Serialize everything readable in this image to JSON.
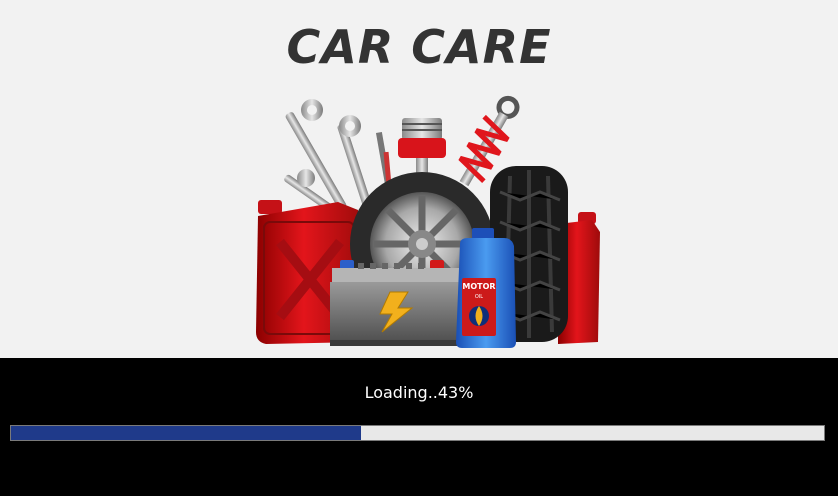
{
  "splash": {
    "logo_title": "CAR CARE",
    "status_text": "Loading..43%",
    "progress_fraction": 0.43,
    "oil_label_top": "MOTOR",
    "oil_label_bottom": "OIL"
  },
  "colors": {
    "top_background": "#f2f2f2",
    "bottom_background": "#000000",
    "progress_fill": "#1f3a8a",
    "progress_track": "#e8e8e8",
    "status_text": "#ffffff",
    "logo_text": "#333333"
  },
  "icons": [
    "wrench-icon",
    "spark-plug-icon",
    "piston-icon",
    "shock-absorber-icon",
    "jerry-can-icon",
    "tire-icon",
    "wheel-rim-icon",
    "car-battery-icon",
    "lightning-bolt-icon",
    "motor-oil-bottle-icon"
  ]
}
